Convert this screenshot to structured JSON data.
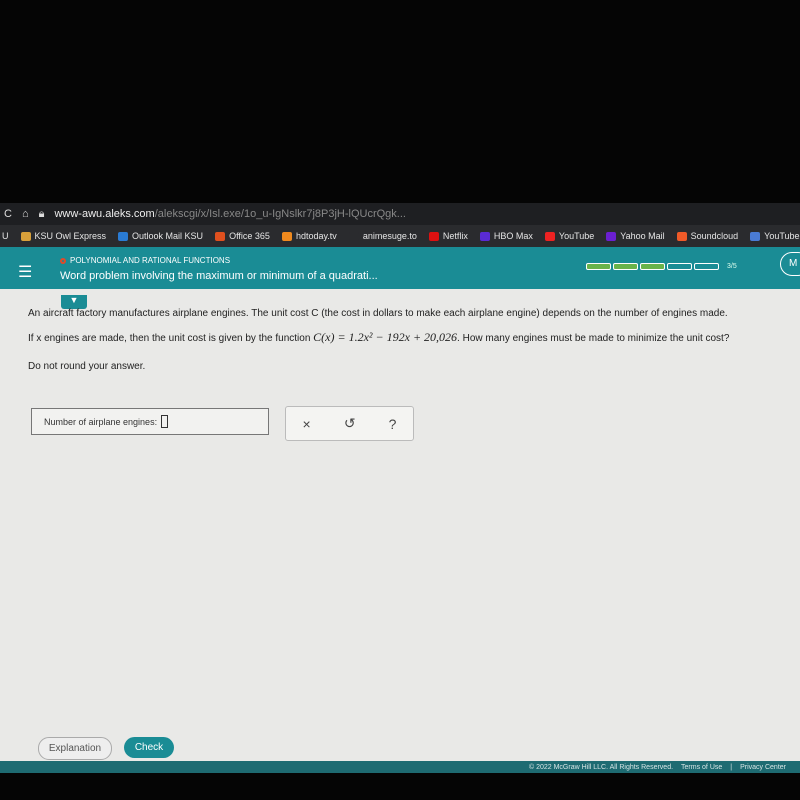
{
  "browser": {
    "url_host": "www-awu.aleks.com",
    "url_path": "/alekscgi/x/Isl.exe/1o_u-IgNslkr7j8P3jH-lQUcrQgk...",
    "bookmarks": [
      "U",
      "KSU Owl Express",
      "Outlook Mail KSU",
      "Office 365",
      "hdtoday.tv",
      "animesuge.to",
      "Netflix",
      "HBO Max",
      "YouTube",
      "Yahoo Mail",
      "Soundcloud",
      "YouTube to"
    ]
  },
  "header": {
    "category": "POLYNOMIAL AND RATIONAL FUNCTIONS",
    "title": "Word problem involving the maximum or minimum of a quadrati...",
    "progress": {
      "completed": 3,
      "total": 5,
      "label": "3/5"
    },
    "menu_button": "M"
  },
  "problem": {
    "line1": "An aircraft factory manufactures airplane engines. The unit cost C (the cost in dollars to make each airplane engine) depends on the number of engines made.",
    "line2_pre": "If x engines are made, then the unit cost is given by the function ",
    "formula": "C(x) = 1.2x² − 192x + 20,026",
    "line2_post": ". How many engines must be made to minimize the unit cost?",
    "line3": "Do not round your answer."
  },
  "answer": {
    "label": "Number of airplane engines:",
    "value": ""
  },
  "tools": {
    "clear": "×",
    "undo": "↺",
    "help": "?"
  },
  "buttons": {
    "explanation": "Explanation",
    "check": "Check"
  },
  "footer": {
    "copyright": "© 2022 McGraw Hill LLC. All Rights Reserved.",
    "terms": "Terms of Use",
    "privacy": "Privacy Center"
  },
  "colors": {
    "teal": "#1a8c95",
    "progress_green": "#69b34a"
  }
}
